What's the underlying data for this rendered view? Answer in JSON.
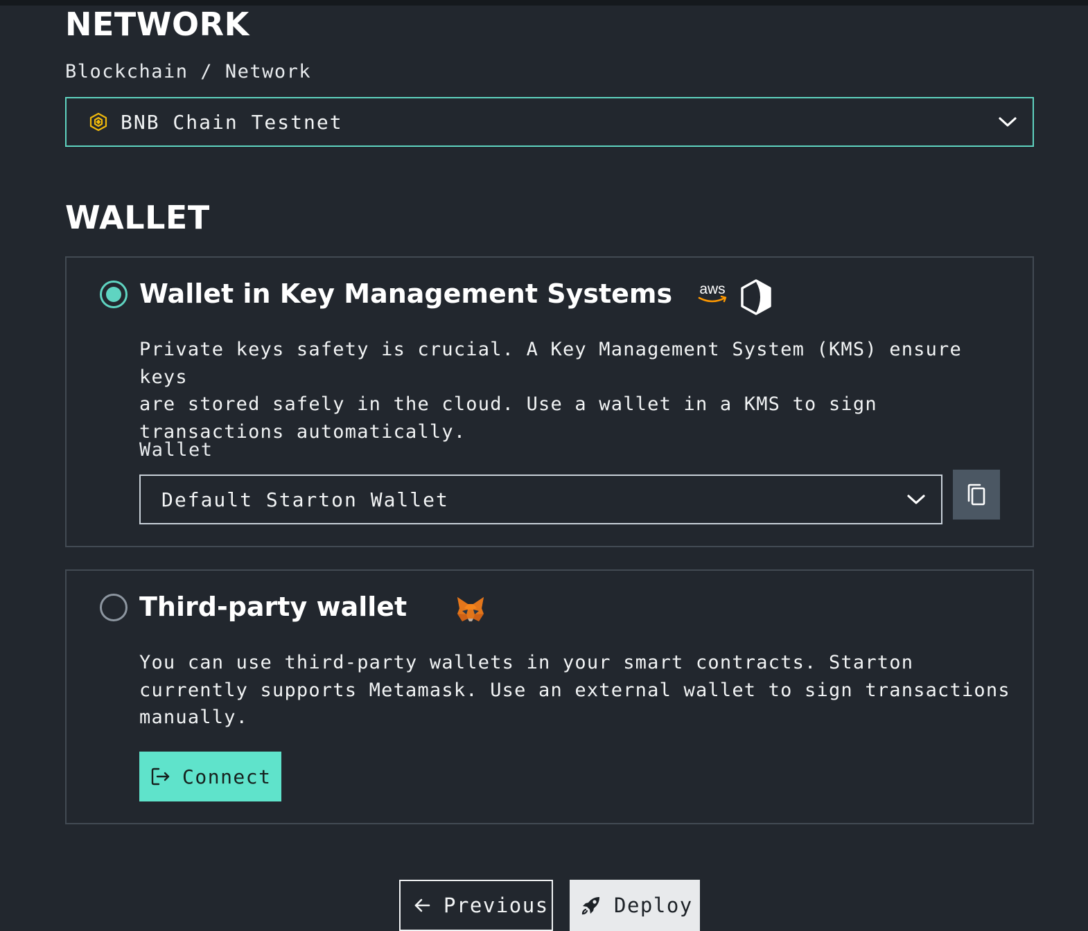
{
  "network": {
    "heading": "NETWORK",
    "field_label": "Blockchain / Network",
    "selected": "BNB Chain Testnet",
    "selected_icon": "bnb-coin-icon"
  },
  "wallet": {
    "heading": "WALLET",
    "kms": {
      "title": "Wallet in Key Management Systems",
      "description": "Private keys safety is crucial. A Key Management System (KMS) ensure keys\nare stored safely in the cloud. Use a wallet in a KMS to sign\ntransactions automatically.",
      "selected": true,
      "logos": [
        "aws-logo",
        "hashicorp-vault-logo"
      ],
      "aws_logo_text": "aws",
      "wallet_label": "Wallet",
      "wallet_selected": "Default Starton Wallet",
      "copy_icon": "copy-icon"
    },
    "third_party": {
      "title": "Third-party wallet",
      "description": "You can use third-party wallets in your smart contracts. Starton\ncurrently supports Metamask. Use an external wallet to sign transactions\nmanually.",
      "selected": false,
      "logo": "metamask-fox-logo",
      "connect_label": "Connect",
      "connect_icon": "login-icon"
    }
  },
  "footer": {
    "previous_label": "Previous",
    "previous_icon": "arrow-left-icon",
    "deploy_label": "Deploy",
    "deploy_icon": "rocket-icon"
  },
  "colors": {
    "background": "#22272e",
    "accent": "#5fd4c1",
    "connect_button": "#5fe3cb",
    "card_border": "#424a53",
    "bnb_yellow": "#f0b90b",
    "aws_orange": "#ff9900",
    "metamask_orange": "#e2761b"
  }
}
